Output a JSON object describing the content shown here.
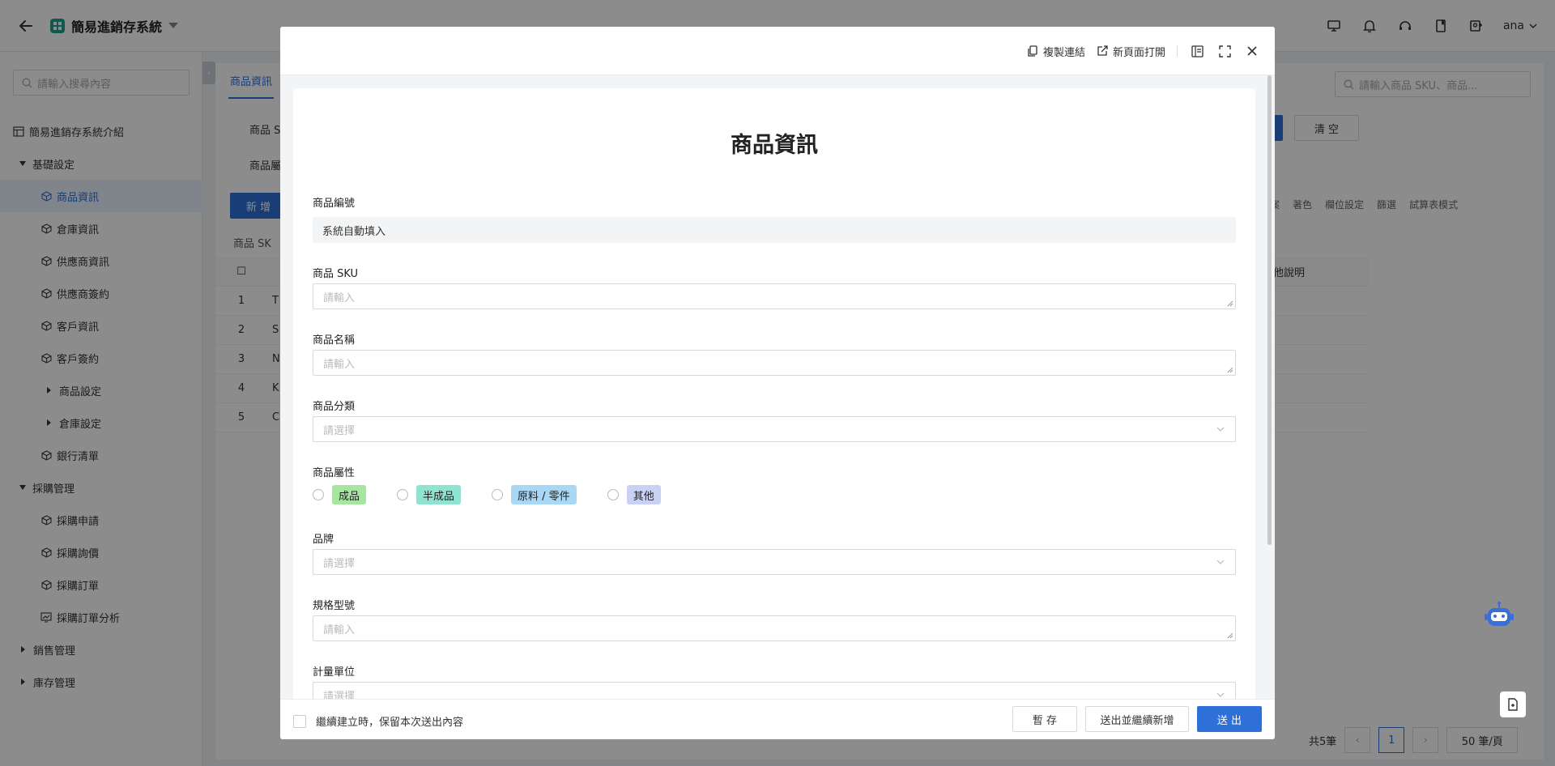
{
  "app": {
    "title": "簡易進銷存系統",
    "user": "ana"
  },
  "sidebar": {
    "search_placeholder": "請輸入搜尋內容",
    "items": [
      {
        "label": "簡易進銷存系統介紹",
        "type": "root"
      },
      {
        "label": "基礎設定",
        "type": "group-open"
      },
      {
        "label": "商品資訊",
        "type": "child",
        "active": true
      },
      {
        "label": "倉庫資訊",
        "type": "child"
      },
      {
        "label": "供應商資訊",
        "type": "child"
      },
      {
        "label": "供應商簽約",
        "type": "child"
      },
      {
        "label": "客戶資訊",
        "type": "child"
      },
      {
        "label": "客戶簽約",
        "type": "child"
      },
      {
        "label": "商品設定",
        "type": "subgroup"
      },
      {
        "label": "倉庫設定",
        "type": "subgroup"
      },
      {
        "label": "銀行清單",
        "type": "child"
      },
      {
        "label": "採購管理",
        "type": "group-open"
      },
      {
        "label": "採購申請",
        "type": "child"
      },
      {
        "label": "採購詢價",
        "type": "child"
      },
      {
        "label": "採購訂單",
        "type": "child"
      },
      {
        "label": "採購訂單分析",
        "type": "child"
      },
      {
        "label": "銷售管理",
        "type": "group-closed"
      },
      {
        "label": "庫存管理",
        "type": "group-closed"
      }
    ]
  },
  "background": {
    "tab": "商品資訊",
    "filter_1": "商品 S",
    "filter_2": "商品屬",
    "new_button": "新 增",
    "column_partial": "商品 SK",
    "search_placeholder": "請輸入商品 SKU、商品...",
    "clear_button": "清 空",
    "toolbar": [
      "案",
      "著色",
      "欄位設定",
      "篩選",
      "試算表模式"
    ],
    "extra_column": "他說明",
    "rows": [
      {
        "num": "1",
        "initial": "T"
      },
      {
        "num": "2",
        "initial": "S"
      },
      {
        "num": "3",
        "initial": "N"
      },
      {
        "num": "4",
        "initial": "K"
      },
      {
        "num": "5",
        "initial": "C"
      }
    ],
    "total": "共5筆",
    "page": "1",
    "page_size": "50 筆/頁"
  },
  "modal": {
    "header": {
      "copy_link": "複製連結",
      "open_new_page": "新頁面打開"
    },
    "title": "商品資訊",
    "fields": {
      "code": {
        "label": "商品編號",
        "value": "系統自動填入"
      },
      "sku": {
        "label": "商品 SKU",
        "placeholder": "請輸入"
      },
      "name": {
        "label": "商品名稱",
        "placeholder": "請輸入"
      },
      "category": {
        "label": "商品分類",
        "placeholder": "請選擇"
      },
      "attribute": {
        "label": "商品屬性",
        "options": [
          {
            "label": "成品",
            "color": "#a6e6a0"
          },
          {
            "label": "半成品",
            "color": "#8fe3d0"
          },
          {
            "label": "原料 / 零件",
            "color": "#a8d8f5"
          },
          {
            "label": "其他",
            "color": "#c9d2f4"
          }
        ]
      },
      "brand": {
        "label": "品牌",
        "placeholder": "請選擇"
      },
      "model": {
        "label": "規格型號",
        "placeholder": "請輸入"
      },
      "unit": {
        "label": "計量單位",
        "placeholder": "請選擇"
      }
    },
    "footer": {
      "keep_label": "繼續建立時，保留本次送出內容",
      "save_draft": "暫 存",
      "submit_continue": "送出並繼續新增",
      "submit": "送 出"
    }
  },
  "colors": {
    "primary": "#2f6fd8",
    "app_logo": "#1e9f8e"
  }
}
